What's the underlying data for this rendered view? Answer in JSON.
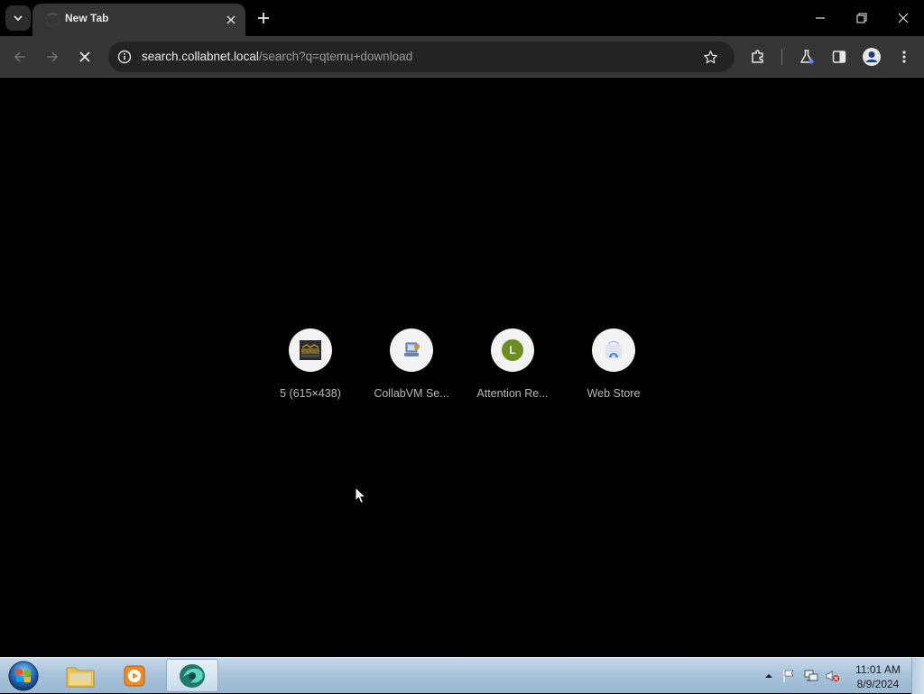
{
  "browser": {
    "tab": {
      "title": "New Tab"
    },
    "omnibox": {
      "host": "search.collabnet.local",
      "path": "/search?q=qtemu+download"
    }
  },
  "shortcuts": [
    {
      "label": "5 (615×438)",
      "icon": "image-thumbnail-icon"
    },
    {
      "label": "CollabVM Se...",
      "icon": "collabvm-icon"
    },
    {
      "label": "Attention Re...",
      "icon": "letter-l-avatar-icon",
      "letter": "L",
      "color": "#6b8e23"
    },
    {
      "label": "Web Store",
      "icon": "web-store-icon"
    }
  ],
  "taskbar": {
    "clock": {
      "time": "11:01 AM",
      "date": "8/9/2024"
    }
  }
}
